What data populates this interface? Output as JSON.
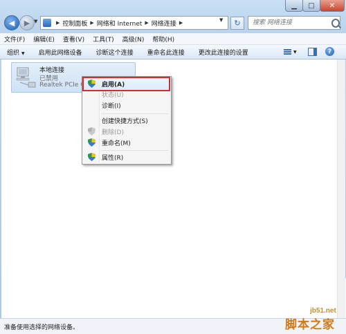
{
  "address": {
    "breadcrumbs": [
      "控制面板",
      "网络和 Internet",
      "网络连接"
    ],
    "search_placeholder": "搜索 网络连接"
  },
  "menubar": [
    "文件(F)",
    "编辑(E)",
    "查看(V)",
    "工具(T)",
    "高级(N)",
    "帮助(H)"
  ],
  "commandbar": {
    "organize": "组织",
    "items": [
      "启用此网络设备",
      "诊断这个连接",
      "重命名此连接",
      "更改此连接的设置"
    ]
  },
  "connection": {
    "name": "本地连接",
    "status": "已禁用",
    "adapter": "Realtek PCIe G"
  },
  "context_menu": {
    "items": [
      {
        "label": "启用(A)",
        "icon": "shield-icon",
        "state": "highlighted"
      },
      {
        "label": "状态(U)",
        "icon": "",
        "state": "disabled"
      },
      {
        "label": "诊断(I)",
        "icon": "",
        "state": "normal"
      },
      {
        "label": "创建快捷方式(S)",
        "icon": "",
        "state": "normal"
      },
      {
        "label": "删除(D)",
        "icon": "shield-icon",
        "state": "disabled"
      },
      {
        "label": "重命名(M)",
        "icon": "shield-icon",
        "state": "normal"
      },
      {
        "label": "属性(R)",
        "icon": "shield-icon",
        "state": "normal"
      }
    ]
  },
  "statusbar": {
    "text": "准备使用选择的网络设备。"
  },
  "watermark": {
    "site": "jb51.net",
    "name": "脚本之家"
  },
  "colors": {
    "highlight_border": "#d52b2b",
    "selection": "#cfe2f5",
    "watermark": "#d07a17"
  }
}
